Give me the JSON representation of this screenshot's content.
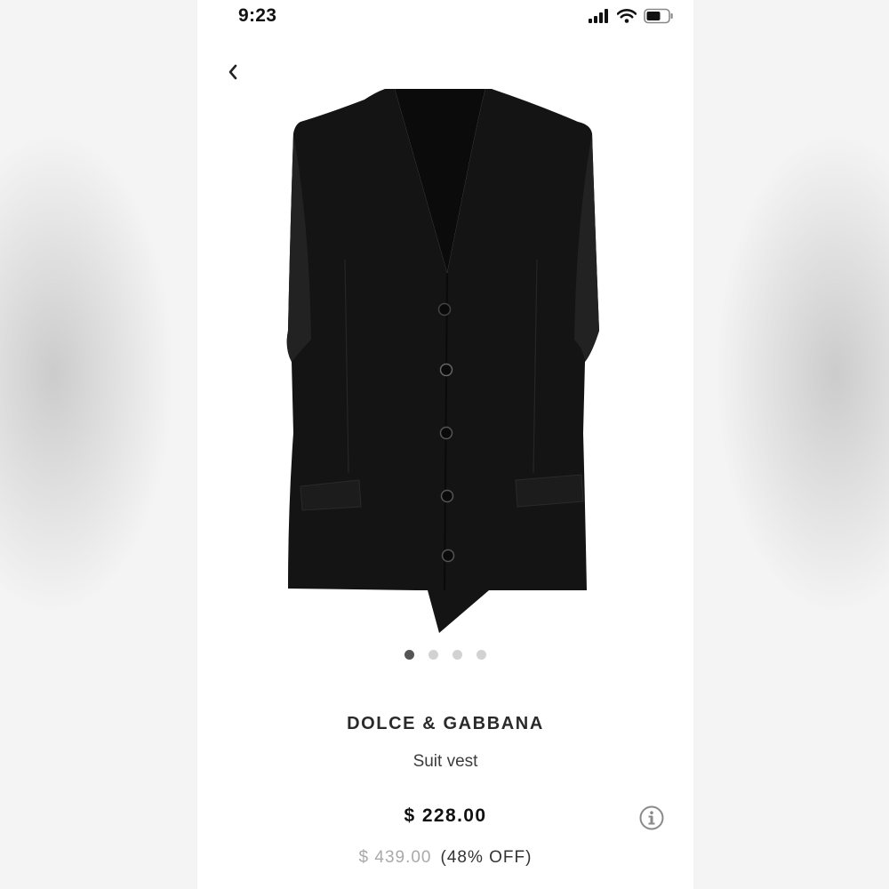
{
  "status_bar": {
    "time": "9:23"
  },
  "icons": {
    "signal": "cellular-signal-icon",
    "wifi": "wifi-icon",
    "battery": "battery-icon",
    "back": "chevron-left-icon",
    "info": "info-icon"
  },
  "product": {
    "brand": "DOLCE & GABBANA",
    "name": "Suit vest",
    "price": "$ 228.00",
    "original_price": "$ 439.00",
    "discount": "(48% OFF)"
  },
  "carousel": {
    "count": 4,
    "active_index": 0
  },
  "colors": {
    "garment": "#141414",
    "dot_active": "#555555",
    "dot_inactive": "#d2d2d2"
  }
}
